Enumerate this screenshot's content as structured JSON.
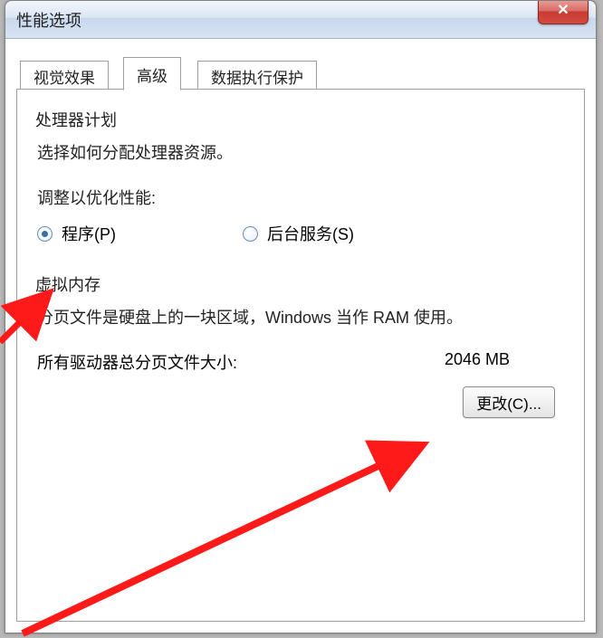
{
  "window": {
    "title": "性能选项",
    "close_glyph": "✕"
  },
  "tabs": {
    "visual": "视觉效果",
    "advanced": "高级",
    "dep": "数据执行保护"
  },
  "processor": {
    "title": "处理器计划",
    "desc": "选择如何分配处理器资源。",
    "adjust_label": "调整以优化性能:",
    "opt_programs": "程序(P)",
    "opt_background": "后台服务(S)"
  },
  "vm": {
    "title": "虚拟内存",
    "desc": "分页文件是硬盘上的一块区域，Windows 当作 RAM 使用。",
    "total_label": "所有驱动器总分页文件大小:",
    "total_value": "2046 MB",
    "change_btn": "更改(C)..."
  }
}
